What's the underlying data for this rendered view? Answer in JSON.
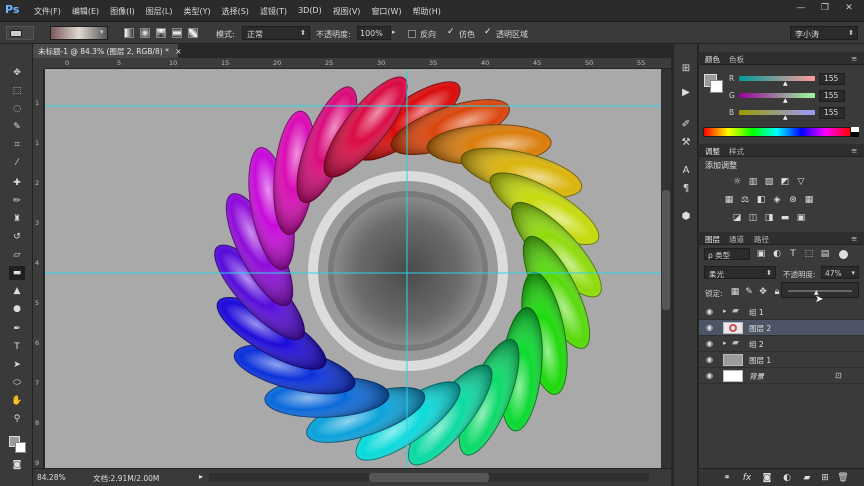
{
  "app": {
    "logo": "Ps"
  },
  "menu": [
    "文件(F)",
    "编辑(E)",
    "图像(I)",
    "图层(L)",
    "类型(Y)",
    "选择(S)",
    "滤镜(T)",
    "3D(D)",
    "视图(V)",
    "窗口(W)",
    "帮助(H)"
  ],
  "window_controls": {
    "minimize": "—",
    "restore": "❐",
    "close": "✕"
  },
  "options": {
    "mode_label": "模式:",
    "mode_value": "正常",
    "opacity_label": "不透明度:",
    "opacity_value": "100%",
    "reverse_label": "反向",
    "dither_label": "仿色",
    "transparency_label": "透明区域",
    "workspace": "李小涛"
  },
  "document": {
    "tab_title": "未标题-1 @ 84.3% (图层 2, RGB/8) *",
    "tab_close": "×",
    "ruler_h_ticks": [
      "0",
      "5",
      "10",
      "15",
      "20",
      "25",
      "30",
      "35",
      "40",
      "45",
      "50",
      "55"
    ],
    "ruler_v_ticks": [
      "1",
      "1",
      "2",
      "3",
      "4",
      "5",
      "6",
      "7",
      "8",
      "9"
    ],
    "zoom": "84.28%",
    "doc_info": "文档:2.91M/2.00M"
  },
  "color_panel": {
    "tabs": [
      "颜色",
      "色板"
    ],
    "channels": [
      {
        "label": "R",
        "value": "155"
      },
      {
        "label": "G",
        "value": "155"
      },
      {
        "label": "B",
        "value": "155"
      }
    ],
    "foreground": "#9b9b9b",
    "background": "#ffffff"
  },
  "adjustments_panel": {
    "tabs": [
      "调整",
      "样式"
    ],
    "title": "添加调整"
  },
  "layers_panel": {
    "tabs": [
      "图层",
      "通道",
      "路径"
    ],
    "filter_label": "ρ 类型",
    "blend_mode": "柔光",
    "opacity_label": "不透明度:",
    "opacity_value": "47%",
    "lock_label": "锁定:",
    "layers": [
      {
        "name": "组 1",
        "type": "group",
        "selected": false
      },
      {
        "name": "图层 2",
        "type": "layer",
        "selected": true
      },
      {
        "name": "组 2",
        "type": "group",
        "selected": false
      },
      {
        "name": "图层 1",
        "type": "layer",
        "selected": false
      },
      {
        "name": "背景",
        "type": "background",
        "selected": false
      }
    ]
  }
}
